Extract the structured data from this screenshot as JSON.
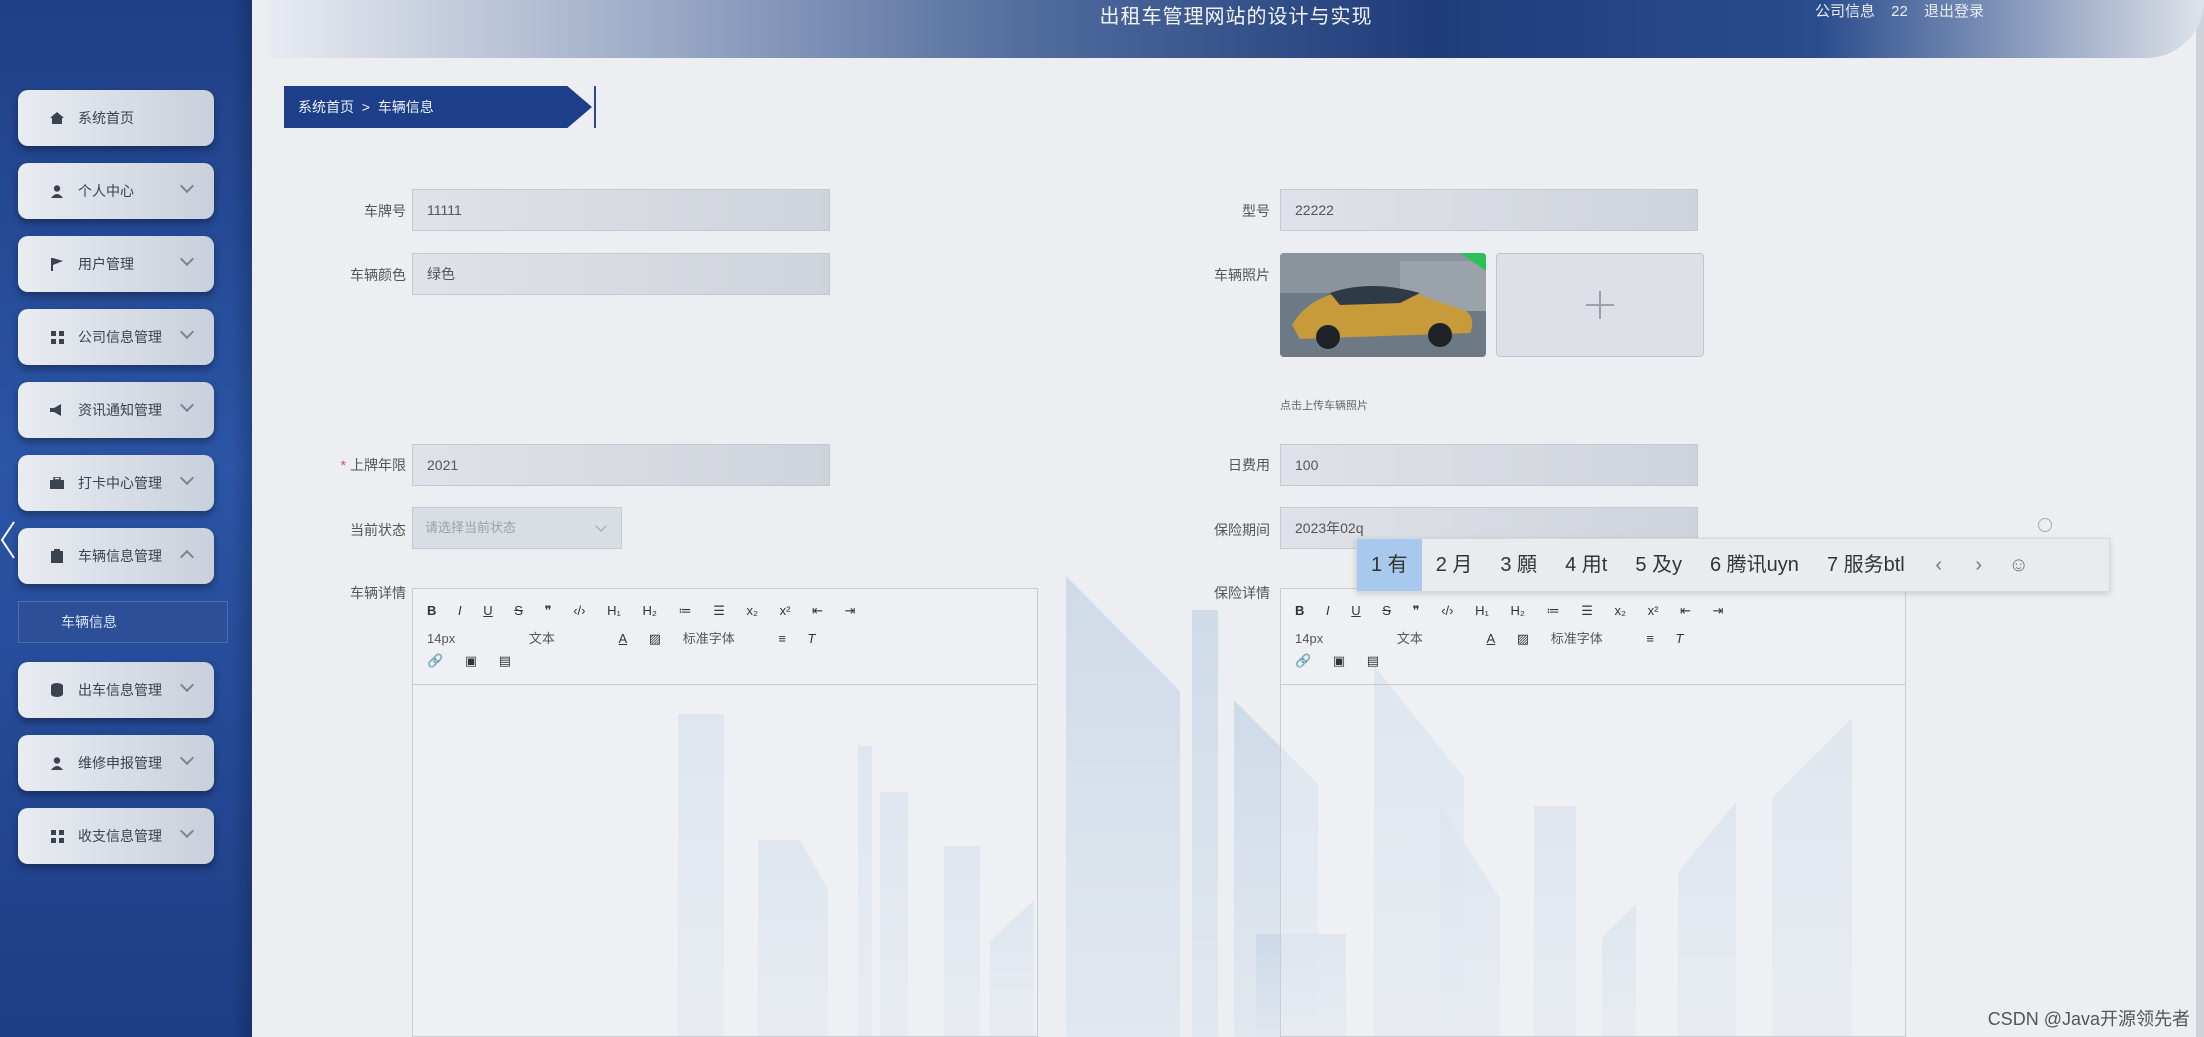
{
  "header": {
    "title": "出租车管理网站的设计与实现",
    "company_info": "公司信息",
    "user_name": "22",
    "logout": "退出登录"
  },
  "sidebar": {
    "items": [
      {
        "label": "系统首页",
        "icon": "home-icon"
      },
      {
        "label": "个人中心",
        "icon": "user-icon"
      },
      {
        "label": "用户管理",
        "icon": "flag-icon"
      },
      {
        "label": "公司信息管理",
        "icon": "grid-icon"
      },
      {
        "label": "资讯通知管理",
        "icon": "megaphone-icon"
      },
      {
        "label": "打卡中心管理",
        "icon": "briefcase-icon"
      },
      {
        "label": "车辆信息管理",
        "icon": "clipboard-icon"
      },
      {
        "label": "出车信息管理",
        "icon": "database-icon"
      },
      {
        "label": "维修申报管理",
        "icon": "user-icon"
      },
      {
        "label": "收支信息管理",
        "icon": "grid-icon"
      }
    ],
    "submenu_active": "车辆信息"
  },
  "breadcrumb": {
    "home": "系统首页",
    "separator": ">",
    "current": "车辆信息"
  },
  "form": {
    "plate_label": "车牌号",
    "plate_value": "11111",
    "model_label": "型号",
    "model_value": "22222",
    "color_label": "车辆颜色",
    "color_value": "绿色",
    "photo_label": "车辆照片",
    "photo_hint": "点击上传车辆照片",
    "year_label": "上牌年限",
    "year_required": "*",
    "year_value": "2021",
    "fee_label": "日费用",
    "fee_value": "100",
    "status_label": "当前状态",
    "status_placeholder": "请选择当前状态",
    "insurance_label": "保险期间",
    "insurance_value": "2023年02q",
    "detail_label": "车辆详情",
    "insurance_detail_label": "保险详情"
  },
  "editor": {
    "row1": [
      "B",
      "I",
      "U",
      "S",
      "❞",
      "‹/›",
      "H₁",
      "H₂",
      "≔",
      "☰",
      "x₂",
      "x²",
      "⇤",
      "⇥"
    ],
    "font_size": "14px",
    "text_style": "文本",
    "font_family": "标准字体",
    "row3": [
      "🔗",
      "▣",
      "▤"
    ]
  },
  "ime": {
    "candidates": [
      "1 有",
      "2 月",
      "3 願",
      "4 用t",
      "5 及y",
      "6 腾讯uyn",
      "7 服务btl"
    ],
    "selected_index": 0
  },
  "watermark": "CSDN @Java开源领先者"
}
